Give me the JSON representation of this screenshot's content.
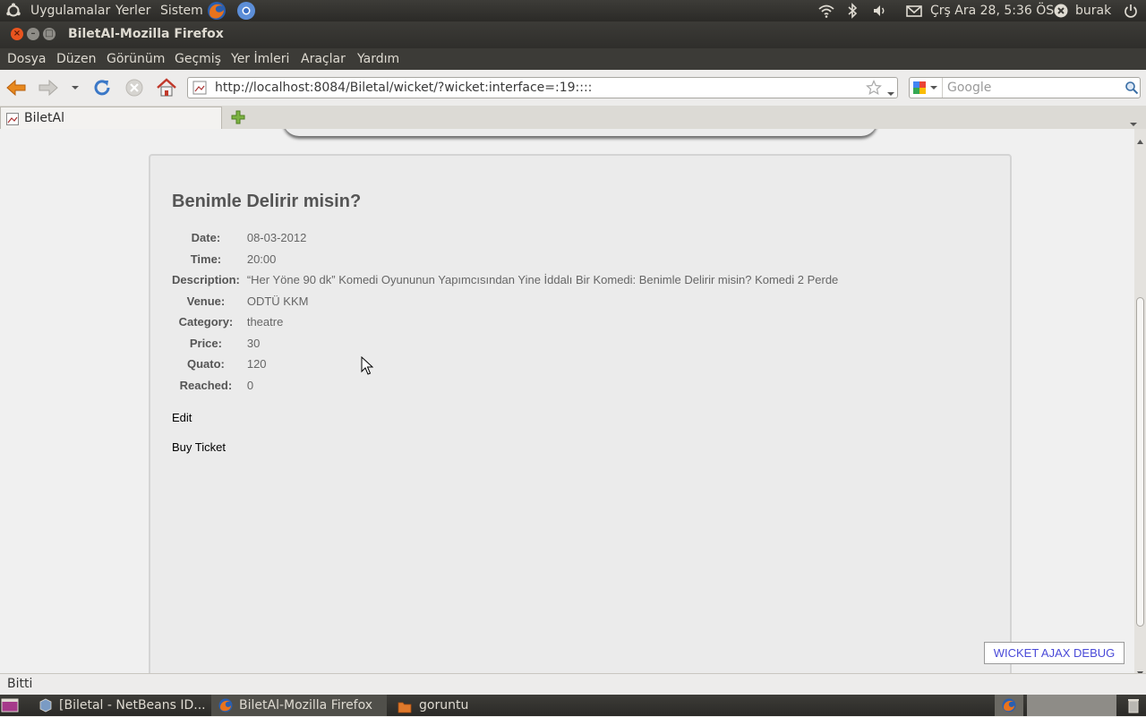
{
  "top_panel": {
    "menus": [
      "Uygulamalar",
      "Yerler",
      "Sistem"
    ],
    "clock": "Çrş Ara 28,  5:36 ÖS",
    "user": "burak"
  },
  "window": {
    "title": "BiletAl-Mozilla Firefox"
  },
  "menubar": {
    "items": [
      "Dosya",
      "Düzen",
      "Görünüm",
      "Geçmiş",
      "Yer İmleri",
      "Araçlar",
      "Yardım"
    ]
  },
  "navbar": {
    "url": "http://localhost:8084/Biletal/wicket/?wicket:interface=:19::::",
    "search_placeholder": "Google"
  },
  "tab": {
    "title": "BiletAl"
  },
  "event": {
    "title": "Benimle Delirir misin?",
    "details": [
      {
        "label": "Date:",
        "value": "08-03-2012"
      },
      {
        "label": "Time:",
        "value": "20:00"
      },
      {
        "label": "Description:",
        "value": "“Her Yöne 90 dk” Komedi Oyununun Yapımcısından Yine İddalı Bir Komedi: Benimle Delirir misin? Komedi 2 Perde"
      },
      {
        "label": "Venue:",
        "value": "ODTÜ KKM"
      },
      {
        "label": "Category:",
        "value": "theatre"
      },
      {
        "label": "Price:",
        "value": "30"
      },
      {
        "label": "Quato:",
        "value": "120"
      },
      {
        "label": "Reached:",
        "value": "0"
      }
    ],
    "edit_label": "Edit",
    "buy_label": "Buy Ticket"
  },
  "debug": {
    "label": "WICKET AJAX DEBUG"
  },
  "statusbar": {
    "text": "Bitti"
  },
  "taskbar": {
    "items": [
      {
        "label": "[Biletal - NetBeans ID..."
      },
      {
        "label": "BiletAl-Mozilla Firefox"
      },
      {
        "label": "goruntu"
      }
    ]
  },
  "colors": {
    "panel": "#3c3b37",
    "close_button": "#e9541f",
    "link_blue": "#4a4ad8"
  }
}
